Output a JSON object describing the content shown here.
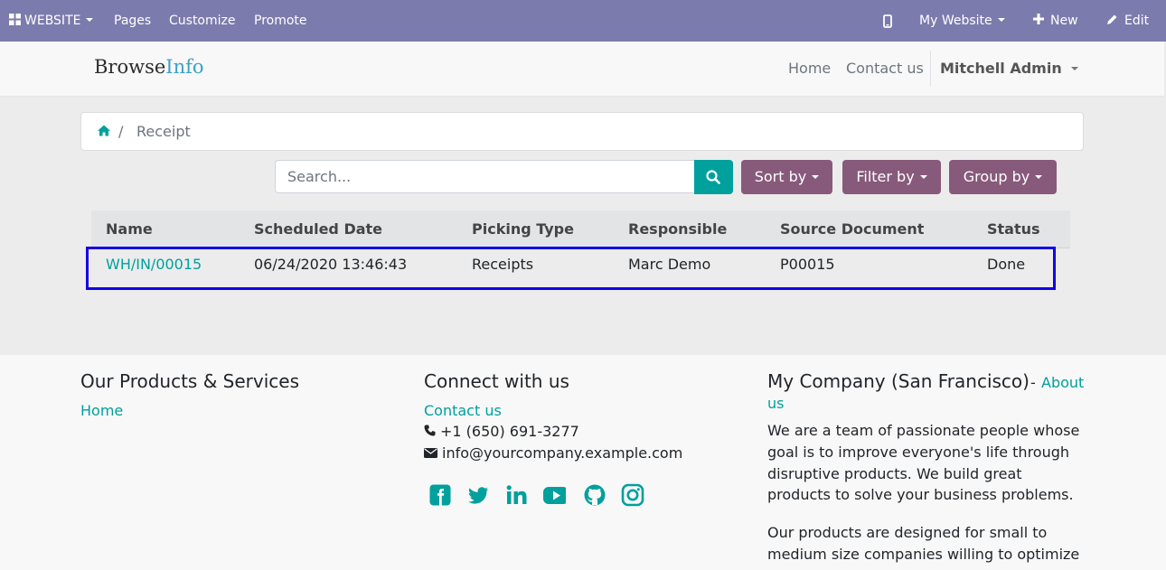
{
  "admin_bar": {
    "website_menu": "WEBSITE",
    "pages": "Pages",
    "customize": "Customize",
    "promote": "Promote",
    "site_switcher": "My Website",
    "new_label": "New",
    "edit_label": "Edit"
  },
  "header": {
    "logo_part1": "Browse",
    "logo_part2": "Info",
    "nav": [
      "Home",
      "Contact us"
    ],
    "user": "Mitchell Admin"
  },
  "breadcrumb": {
    "separator": "/",
    "current": "Receipt"
  },
  "search": {
    "placeholder": "Search..."
  },
  "buttons": {
    "sort": "Sort by",
    "filter": "Filter by",
    "group": "Group by"
  },
  "table": {
    "columns": [
      "Name",
      "Scheduled Date",
      "Picking Type",
      "Responsible",
      "Source Document",
      "Status"
    ],
    "rows": [
      [
        "WH/IN/00015",
        "06/24/2020 13:46:43",
        "Receipts",
        "Marc Demo",
        "P00015",
        "Done"
      ]
    ]
  },
  "footer": {
    "products": {
      "title": "Our Products & Services",
      "links": [
        "Home"
      ]
    },
    "connect": {
      "title": "Connect with us",
      "contact_link": "Contact us",
      "phone": "+1 (650) 691-3277",
      "email": "info@yourcompany.example.com",
      "social": [
        "facebook-icon",
        "twitter-icon",
        "linkedin-icon",
        "youtube-icon",
        "github-icon",
        "instagram-icon"
      ]
    },
    "company": {
      "title": "My Company (San Francisco)",
      "dash": "-",
      "about_line1": "About",
      "about_line2": "us",
      "para1": [
        "We are a team of passionate people whose",
        "goal is to improve everyone's life through",
        "disruptive products. We build great",
        "products to solve your business problems."
      ],
      "para2": [
        "Our products are designed for small to",
        "medium size companies willing to optimize"
      ]
    }
  },
  "colors": {
    "admin_bar": "#7c7bad",
    "accent": "#00a09d",
    "primary_button": "#875a7b",
    "highlight": "#1400e6"
  }
}
